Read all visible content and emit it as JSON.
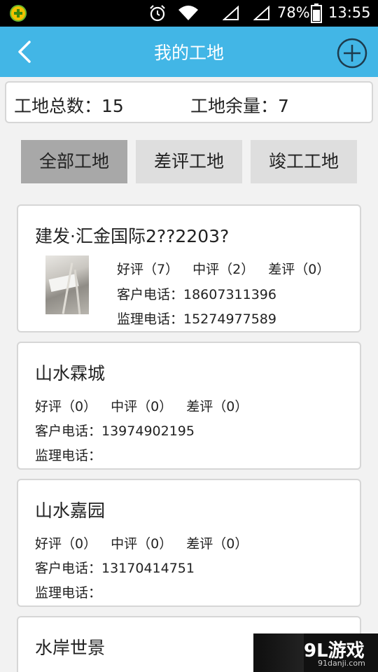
{
  "status_bar": {
    "battery_percent": "78%",
    "time": "13:55"
  },
  "header": {
    "title": "我的工地"
  },
  "summary": {
    "total": "工地总数：15",
    "remaining": "工地余量：7"
  },
  "tabs": [
    {
      "label": "全部工地",
      "active": true
    },
    {
      "label": "差评工地",
      "active": false
    },
    {
      "label": "竣工工地",
      "active": false
    }
  ],
  "sites": [
    {
      "name": "建发·汇金国际2??2203?",
      "good": "好评（7）",
      "medium": "中评（2）",
      "bad": "差评（0）",
      "client_phone": "客户电话：18607311396",
      "supervisor_phone": "监理电话：15274977589"
    },
    {
      "name": "山水霖城",
      "good": "好评（0）",
      "medium": "中评（0）",
      "bad": "差评（0）",
      "client_phone": "客户电话：13974902195",
      "supervisor_phone": "监理电话："
    },
    {
      "name": "山水嘉园",
      "good": "好评（0）",
      "medium": "中评（0）",
      "bad": "差评（0）",
      "client_phone": "客户电话：13170414751",
      "supervisor_phone": "监理电话："
    },
    {
      "name": "水岸世景"
    }
  ],
  "watermark": {
    "logo": "9L游戏",
    "url": "91danji.com"
  },
  "colors": {
    "header_bg": "#42b6e6",
    "status_bar_bg": "#000000",
    "tab_active_bg": "#a8a8a8",
    "tab_inactive_bg": "#dedede"
  }
}
